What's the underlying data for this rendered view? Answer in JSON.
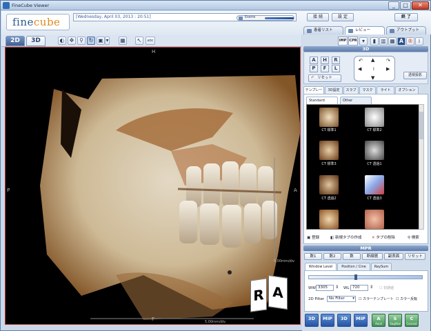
{
  "window": {
    "title": "FineCube Viewer",
    "min": "_",
    "max": "□",
    "close": "✕"
  },
  "header": {
    "logo_text_1": "fine",
    "logo_text_2": "cube",
    "date_text": "[Wednesday, April 03, 2013 : 20:51]",
    "series_label": "Eserie",
    "btn_settings_1": "接 続",
    "btn_settings_2": "設 定",
    "btn_exit": "終 了",
    "tabs": [
      {
        "label": "患者リスト"
      },
      {
        "label": "レビュー"
      },
      {
        "label": "アウトプット"
      }
    ]
  },
  "view_tabs": [
    {
      "label": "2D"
    },
    {
      "label": "3D"
    }
  ],
  "viewport": {
    "top_label": "H",
    "left_label": "P",
    "right_label": "A",
    "bottom_label": "F",
    "scale_right": "5.00mm/div",
    "scale_bottom": "5.00mm/div",
    "cube_face_1": "R",
    "cube_face_2": "A"
  },
  "right": {
    "section_3d": "3D",
    "mode_buttons": [
      "IMP",
      "CPR"
    ],
    "orient": [
      "A",
      "H",
      "R",
      "P",
      "F",
      "L"
    ],
    "reset": "リセット",
    "orth": "透視投影",
    "panel_tabs": [
      "テンプレート",
      "3D設定",
      "スラブ",
      "マスク",
      "ライト",
      "オプション"
    ],
    "sub_tabs": [
      "Standard",
      "Other"
    ],
    "thumbs": [
      "CT 標準1",
      "CT 標準2",
      "CT 標準3",
      "CT 透過1",
      "CT 透過2",
      "CT 透過3",
      "",
      ""
    ],
    "actions": [
      "登録",
      "新規タブの作成",
      "タブの削除",
      "検索"
    ],
    "section_mpr": "MPR",
    "mpr_buttons": [
      "数1",
      "数2",
      "数",
      "断線層",
      "副表面",
      "リセット"
    ],
    "mpr_tabs": [
      "Window Level",
      "Position / Cine",
      "RaySum"
    ],
    "ww_label": "WW",
    "ww_value": "3305",
    "wl_label": "WL",
    "wl_value": "720",
    "auto_label": "初期値",
    "filter_label": "2D Filter",
    "filter_value": "No Filter",
    "check1": "カラーテンプレート",
    "check2": "カラー反転",
    "bottom_buttons": [
      {
        "label": "3D",
        "sub": ""
      },
      {
        "label": "MIP",
        "sub": ""
      },
      {
        "label": "3D",
        "sub": ""
      },
      {
        "label": "MIP",
        "sub": ""
      },
      {
        "label": "A",
        "sub": "Axial"
      },
      {
        "label": "S",
        "sub": "Sagittal"
      },
      {
        "label": "C",
        "sub": "Coronal"
      }
    ]
  }
}
